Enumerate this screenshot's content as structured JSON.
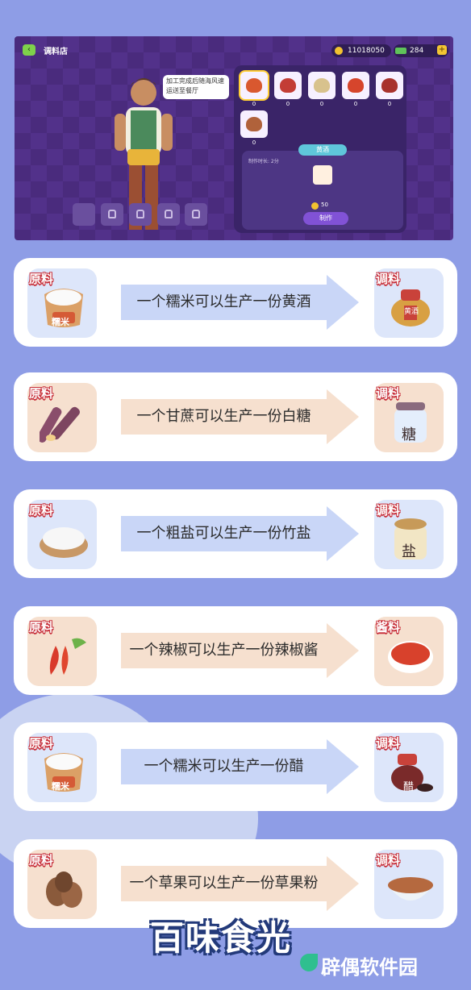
{
  "game": {
    "shop_title": "调料店",
    "coins": "11018050",
    "cash": "284",
    "speech": "加工完成后随海风速运送至餐厅",
    "item_counts": [
      "0",
      "0",
      "0",
      "0",
      "0",
      "0"
    ],
    "detail": {
      "title": "黄酒",
      "time_label": "制作时长: 2分",
      "cost": "50",
      "make_button": "制作"
    }
  },
  "recipes": [
    {
      "ingredient_tag": "原料",
      "product_tag": "调料",
      "text": "一个糯米可以生产一份黄酒",
      "ingredient_label": "糯米",
      "product_label": "黄酒",
      "arrow_color": "#c9d6f7"
    },
    {
      "ingredient_tag": "原料",
      "product_tag": "调料",
      "text": "一个甘蔗可以生产一份白糖",
      "ingredient_label": "",
      "product_label": "糖",
      "arrow_color": "#f6e0cf"
    },
    {
      "ingredient_tag": "原料",
      "product_tag": "调料",
      "text": "一个粗盐可以生产一份竹盐",
      "ingredient_label": "",
      "product_label": "盐",
      "arrow_color": "#c9d6f7"
    },
    {
      "ingredient_tag": "原料",
      "product_tag": "酱料",
      "text": "一个辣椒可以生产一份辣椒酱",
      "ingredient_label": "",
      "product_label": "",
      "arrow_color": "#f6e0cf"
    },
    {
      "ingredient_tag": "原料",
      "product_tag": "调料",
      "text": "一个糯米可以生产一份醋",
      "ingredient_label": "糯米",
      "product_label": "醋",
      "arrow_color": "#c9d6f7"
    },
    {
      "ingredient_tag": "原料",
      "product_tag": "调料",
      "text": "一个草果可以生产一份草果粉",
      "ingredient_label": "",
      "product_label": "",
      "arrow_color": "#f6e0cf"
    }
  ],
  "footer": {
    "logo": "百味食光",
    "watermark": "辟偶软件园"
  }
}
